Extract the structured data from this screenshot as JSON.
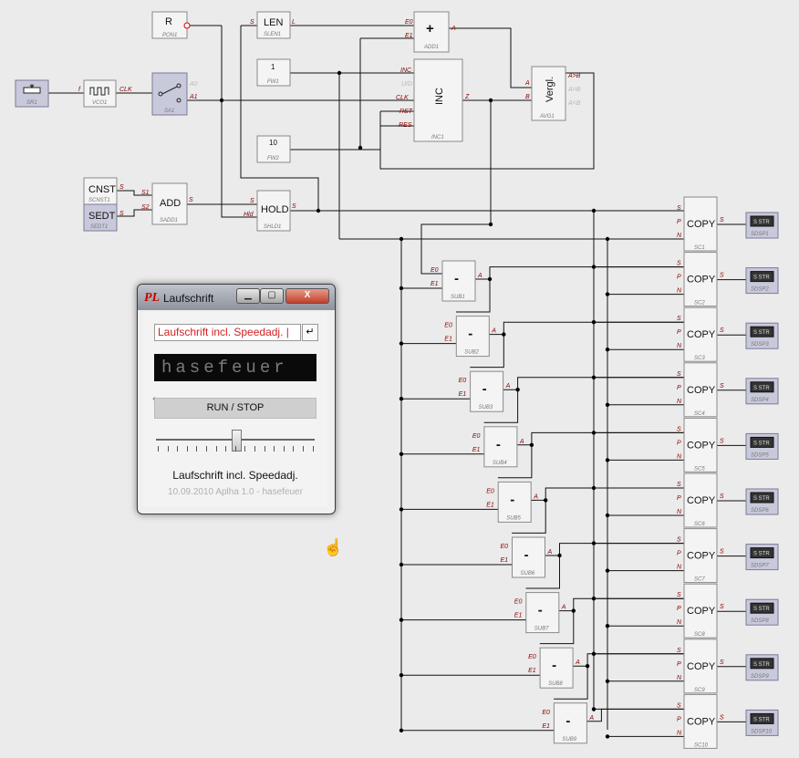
{
  "blocks": {
    "pon1": {
      "label": "R",
      "caption": "PON1"
    },
    "len": {
      "label": "LEN",
      "caption": "SLEN1",
      "in_port": "S",
      "out_port": "L"
    },
    "add1": {
      "label": "+",
      "caption": "ADD1",
      "in1": "E0",
      "in2": "E1",
      "out": "A"
    },
    "fw1": {
      "label": "1",
      "caption": "FW1"
    },
    "fw2": {
      "label": "10",
      "caption": "FW2"
    },
    "inc": {
      "label": "INC",
      "caption": "INC1",
      "ports": [
        "INC",
        "U/D",
        "CLK",
        "RST",
        "RES"
      ],
      "out": "Z"
    },
    "vergl": {
      "label": "Vergl.",
      "caption": "AVG1",
      "in_a": "A",
      "in_b": "B",
      "outs": [
        "A>B",
        "A=B",
        "A<B"
      ]
    },
    "sr1": {
      "caption": "SR1",
      "out": "f"
    },
    "vco1": {
      "caption": "VCO1",
      "out": "CLK"
    },
    "sa1": {
      "caption": "SA1",
      "p1": "A0",
      "p2": "A1"
    },
    "cnst": {
      "label": "CNST",
      "caption": "SCNST1",
      "out": "S"
    },
    "sedt": {
      "label": "SEDT",
      "caption": "SEDT1",
      "out": "S"
    },
    "add": {
      "label": "ADD",
      "caption": "SADD1",
      "in1": "S1",
      "in2": "S2",
      "out": "S"
    },
    "hold": {
      "label": "HOLD",
      "caption": "SHLD1",
      "in": "S",
      "in2": "Hld",
      "out": "S"
    },
    "copy_label": "COPY",
    "copy_ports": [
      "S",
      "P",
      "N"
    ],
    "copy_out": "S",
    "copies": [
      "SC1",
      "SC2",
      "SC3",
      "SC4",
      "SC5",
      "SC6",
      "SC7",
      "SC8",
      "SC9",
      "SC10"
    ],
    "disp_label": "S STR",
    "disps": [
      "SDSP1",
      "SDSP2",
      "SDSP3",
      "SDSP4",
      "SDSP5",
      "SDSP6",
      "SDSP7",
      "SDSP8",
      "SDSP9",
      "SDSP10"
    ],
    "sub_label": "-",
    "sub_ports": [
      "E0",
      "E1"
    ],
    "sub_out": "A",
    "subs": [
      "SUB1",
      "SUB2",
      "SUB3",
      "SUB4",
      "SUB5",
      "SUB6",
      "SUB7",
      "SUB8",
      "SUB9"
    ]
  },
  "window": {
    "title": "Laufschrift",
    "logo": "PL",
    "min": "▁",
    "max": "▢",
    "close": "X",
    "input_value": "Laufschrift incl. Speedadj. |",
    "enter": "↵",
    "marquee": "hasefeuer",
    "run_button": "RUN / STOP",
    "slider_value": 0.5,
    "caption": "Laufschrift incl. Speedadj.",
    "footer": "10.09.2010 Aplha 1.0 - hasefeuer"
  }
}
